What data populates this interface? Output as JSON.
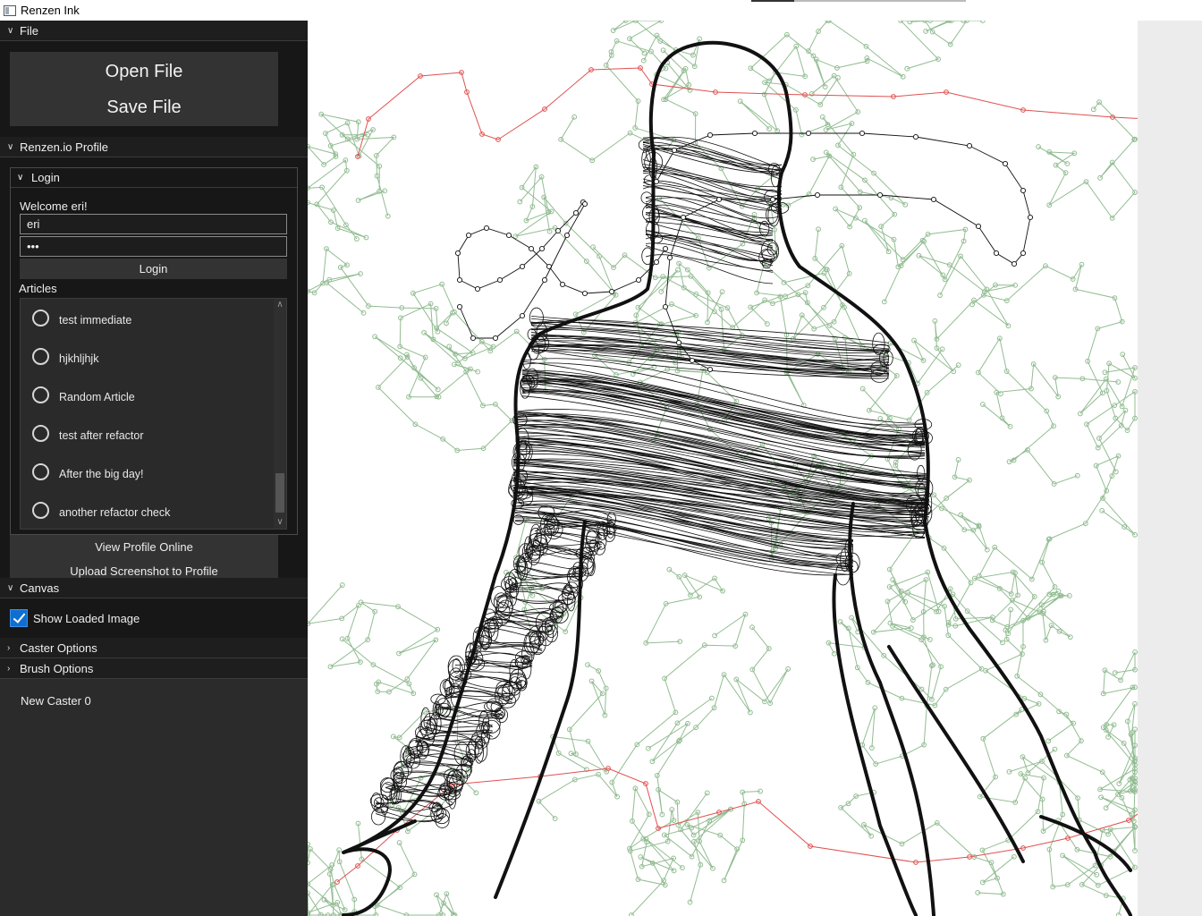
{
  "window": {
    "title": "Renzen Ink"
  },
  "sections": {
    "file": {
      "title": "File",
      "open_label": "Open File",
      "save_label": "Save File"
    },
    "profile": {
      "title": "Renzen.io Profile",
      "login": {
        "title": "Login",
        "welcome": "Welcome eri!",
        "username_value": "eri",
        "password_value": "•••",
        "login_label": "Login"
      },
      "articles_label": "Articles",
      "articles": [
        {
          "label": "test immediate"
        },
        {
          "label": "hjkhljhjk"
        },
        {
          "label": "Random Article"
        },
        {
          "label": "test after refactor"
        },
        {
          "label": "After the big day!"
        },
        {
          "label": "another refactor check"
        }
      ],
      "view_profile_label": "View Profile Online",
      "upload_label": "Upload Screenshot to Profile"
    },
    "canvas": {
      "title": "Canvas",
      "show_image_label": "Show Loaded Image",
      "show_image_checked": true
    },
    "caster": {
      "title": "Caster Options"
    },
    "brush": {
      "title": "Brush Options"
    },
    "caster_list": [
      "New Caster 0"
    ]
  },
  "colors": {
    "panel_bg": "#2b2b2b",
    "header_bg": "#1e1e1e",
    "accent": "#0f6fd1",
    "mesh_green": "#7fb17f",
    "path_red": "#e05050",
    "ink": "#111111"
  },
  "icons": {
    "collapse": "chevron-down-icon",
    "expand": "chevron-right-icon"
  }
}
